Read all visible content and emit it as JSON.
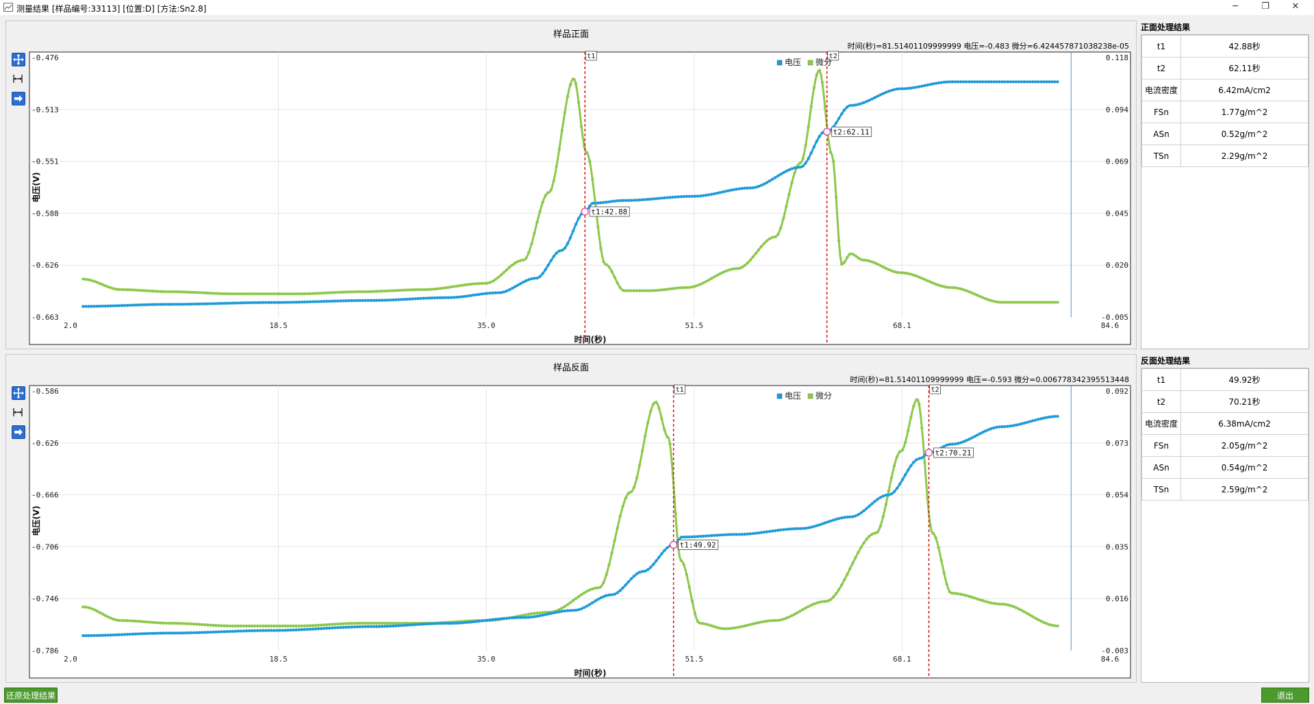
{
  "window": {
    "title": "测量结果 [样品编号:33113] [位置:D] [方法:Sn2.8]",
    "minimize": "─",
    "restore": "❐",
    "close": "✕"
  },
  "front": {
    "title": "样品正面",
    "readout": "时间(秒)=81.51401109999999 电压=-0.483 微分=6.424457871038238e-05",
    "chart_data": {
      "type": "line",
      "xlabel": "时间(秒)",
      "ylabel": "电压(V)",
      "xlim": [
        2.0,
        84.6
      ],
      "x_ticks": [
        "2.0",
        "18.5",
        "35.0",
        "51.5",
        "68.1",
        "84.6"
      ],
      "ylim_left": [
        -0.663,
        -0.476
      ],
      "y_ticks_left": [
        "-0.476",
        "-0.513",
        "-0.551",
        "-0.588",
        "-0.626",
        "-0.663"
      ],
      "ylim_right": [
        -0.005,
        0.118
      ],
      "y_ticks_right": [
        "0.118",
        "0.094",
        "0.069",
        "0.045",
        "0.020",
        "-0.005"
      ],
      "legend": [
        "电压",
        "微分"
      ],
      "legend_position": "top",
      "series": [
        {
          "name": "电压",
          "color": "#1f9ad9",
          "axis": "left",
          "x": [
            3,
            10,
            18,
            26,
            32,
            36,
            39,
            41,
            42.88,
            43.5,
            46,
            51.5,
            56,
            60,
            62,
            62.11,
            64,
            68,
            72,
            80.5
          ],
          "y": [
            -0.6553,
            -0.6538,
            -0.6525,
            -0.651,
            -0.649,
            -0.6455,
            -0.635,
            -0.615,
            -0.587,
            -0.581,
            -0.579,
            -0.576,
            -0.57,
            -0.555,
            -0.529,
            -0.5295,
            -0.5105,
            -0.4985,
            -0.4935,
            -0.4935
          ]
        },
        {
          "name": "微分",
          "color": "#8cc84b",
          "axis": "right",
          "x": [
            3,
            6,
            10,
            15,
            20,
            25,
            30,
            35,
            38,
            40,
            42,
            43,
            44.5,
            46,
            48,
            51,
            55,
            58,
            60,
            61.5,
            62.5,
            63.3,
            64,
            65,
            68,
            72,
            76,
            80.5
          ],
          "y": [
            0.013,
            0.008,
            0.007,
            0.006,
            0.006,
            0.007,
            0.008,
            0.011,
            0.022,
            0.054,
            0.108,
            0.073,
            0.02,
            0.0075,
            0.0075,
            0.009,
            0.018,
            0.033,
            0.068,
            0.112,
            0.072,
            0.02,
            0.025,
            0.022,
            0.016,
            0.009,
            0.002,
            0.002
          ]
        }
      ],
      "markers": [
        {
          "label": "t1",
          "x": 42.88,
          "tag": "t1:42.88"
        },
        {
          "label": "t2",
          "x": 62.11,
          "tag": "t2:62.11"
        }
      ],
      "cursor_x": 81.514
    }
  },
  "back": {
    "title": "样品反面",
    "readout": "时间(秒)=81.51401109999999 电压=-0.593 微分=0.006778342395513448",
    "chart_data": {
      "type": "line",
      "xlabel": "时间(秒)",
      "ylabel": "电压(V)",
      "xlim": [
        2.0,
        84.6
      ],
      "x_ticks": [
        "2.0",
        "18.5",
        "35.0",
        "51.5",
        "68.1",
        "84.6"
      ],
      "ylim_left": [
        -0.786,
        -0.586
      ],
      "y_ticks_left": [
        "-0.586",
        "-0.626",
        "-0.666",
        "-0.706",
        "-0.746",
        "-0.786"
      ],
      "ylim_right": [
        -0.003,
        0.092
      ],
      "y_ticks_right": [
        "0.092",
        "0.073",
        "0.054",
        "0.035",
        "0.016",
        "-0.003"
      ],
      "legend": [
        "电压",
        "微分"
      ],
      "legend_position": "top",
      "series": [
        {
          "name": "电压",
          "color": "#1f9ad9",
          "axis": "left",
          "x": [
            3,
            10,
            18,
            26,
            32,
            38,
            42,
            45,
            47.5,
            49.92,
            50.6,
            55,
            60,
            64,
            67,
            69.5,
            70.21,
            72,
            76,
            80.5
          ],
          "y": [
            -0.7745,
            -0.7725,
            -0.7705,
            -0.7675,
            -0.765,
            -0.7605,
            -0.755,
            -0.743,
            -0.725,
            -0.7045,
            -0.6985,
            -0.6965,
            -0.692,
            -0.683,
            -0.666,
            -0.638,
            -0.6335,
            -0.627,
            -0.6135,
            -0.6055
          ]
        },
        {
          "name": "微分",
          "color": "#8cc84b",
          "axis": "right",
          "x": [
            3,
            6,
            10,
            15,
            20,
            25,
            30,
            35,
            40,
            44,
            46.5,
            48.5,
            49.5,
            50.5,
            52,
            54,
            58,
            62,
            66,
            68,
            69.3,
            70.5,
            72,
            76,
            80.5
          ],
          "y": [
            0.013,
            0.008,
            0.007,
            0.006,
            0.006,
            0.007,
            0.007,
            0.008,
            0.011,
            0.02,
            0.055,
            0.088,
            0.075,
            0.03,
            0.007,
            0.005,
            0.008,
            0.015,
            0.04,
            0.07,
            0.089,
            0.04,
            0.018,
            0.014,
            0.006
          ]
        }
      ],
      "markers": [
        {
          "label": "t1",
          "x": 49.92,
          "tag": "t1:49.92"
        },
        {
          "label": "t2",
          "x": 70.21,
          "tag": "t2:70.21"
        }
      ],
      "cursor_x": 81.514
    }
  },
  "front_results": {
    "title": "正面处理结果",
    "rows": [
      {
        "k": "t1",
        "v": "42.88秒"
      },
      {
        "k": "t2",
        "v": "62.11秒"
      },
      {
        "k": "电流密度",
        "v": "6.42mA/cm2"
      },
      {
        "k": "FSn",
        "v": "1.77g/m^2"
      },
      {
        "k": "ASn",
        "v": "0.52g/m^2"
      },
      {
        "k": "TSn",
        "v": "2.29g/m^2"
      }
    ]
  },
  "back_results": {
    "title": "反面处理结果",
    "rows": [
      {
        "k": "t1",
        "v": "49.92秒"
      },
      {
        "k": "t2",
        "v": "70.21秒"
      },
      {
        "k": "电流密度",
        "v": "6.38mA/cm2"
      },
      {
        "k": "FSn",
        "v": "2.05g/m^2"
      },
      {
        "k": "ASn",
        "v": "0.54g/m^2"
      },
      {
        "k": "TSn",
        "v": "2.59g/m^2"
      }
    ]
  },
  "buttons": {
    "restore_results": "还原处理结果",
    "exit": "退出"
  },
  "colors": {
    "voltage": "#1f9ad9",
    "derivative": "#8cc84b",
    "marker_line": "#d42020",
    "button_green": "#4a9a2c"
  }
}
